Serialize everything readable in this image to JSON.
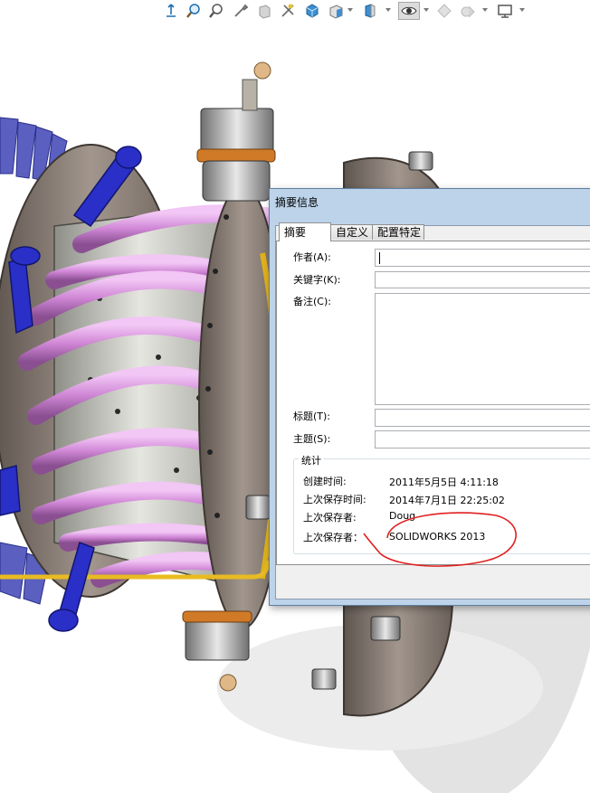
{
  "toolbar": {
    "icons": [
      "view-orientation-icon",
      "zoom-to-fit-icon",
      "zoom-to-area-icon",
      "previous-view-icon",
      "section-view-icon",
      "dynamic-annotation-icon",
      "view-orientation-cube-icon",
      "display-style-icon",
      "hide-show-items-icon",
      "edit-appearance-icon",
      "apply-scene-icon",
      "view-settings-icon"
    ]
  },
  "dialog": {
    "title": "摘要信息",
    "tabs": [
      {
        "label": "摘要",
        "active": true
      },
      {
        "label": "自定义",
        "active": false
      },
      {
        "label": "配置特定",
        "active": false
      }
    ],
    "fields": {
      "author_label": "作者(A):",
      "author_value": "",
      "keywords_label": "关键字(K):",
      "keywords_value": "",
      "comments_label": "备注(C):",
      "comments_value": "",
      "title_label": "标题(T):",
      "title_value": "",
      "subject_label": "主题(S):",
      "subject_value": ""
    },
    "stats": {
      "group_title": "统计",
      "created_label": "创建时间:",
      "created_value": "2011年5月5日 4:11:18",
      "last_saved_label": "上次保存时间:",
      "last_saved_value": "2014年7月1日 22:25:02",
      "last_saved_by_label": "上次保存者:",
      "last_saved_by_value": "Doug",
      "last_saved_with_label": "上次保存者：",
      "last_saved_with_value": "SOLIDWORKS 2013"
    }
  },
  "colors": {
    "tube": "#d59ad9",
    "flange": "#8c7f78",
    "blue_part": "#2a2fc8",
    "gold_ring": "#e0b21a",
    "annotation": "#e02020",
    "dialog_frame": "#bcd3ea"
  }
}
